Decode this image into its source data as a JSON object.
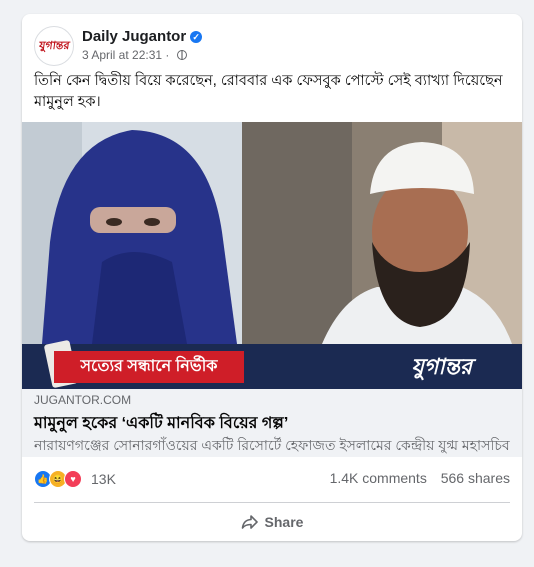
{
  "post": {
    "page_name": "Daily Jugantor",
    "avatar_text": "যুগান্তর",
    "timestamp": "3 April at 22:31",
    "separator": "·",
    "caption": "তিনি কেন দ্বিতীয় বিয়ে করেছেন, রোববার এক ফেসবুক পোস্টে সেই ব্যাখ্যা দিয়েছেন মামুনুল হক।"
  },
  "media": {
    "banner_text": "সত্যের সন্ধানে নির্ভীক",
    "banner_logo": "যুগান্তর"
  },
  "link": {
    "domain": "JUGANTOR.COM",
    "title": "মামুনুল হকের ‘একটি মানবিক বিয়ের গল্প’",
    "description": "নারায়ণগঞ্জের সোনারগাঁওয়ের একটি রিসোর্টে হেফাজত ইসলামের কেন্দ্রীয় যুগ্ম মহাসচিব"
  },
  "stats": {
    "reactions_count": "13K",
    "comments": "1.4K comments",
    "shares": "566 shares"
  },
  "actions": {
    "share_label": "Share"
  },
  "colors": {
    "accent": "#1877f2",
    "banner_red": "#cf1e28",
    "banner_navy": "#1b2a52"
  }
}
